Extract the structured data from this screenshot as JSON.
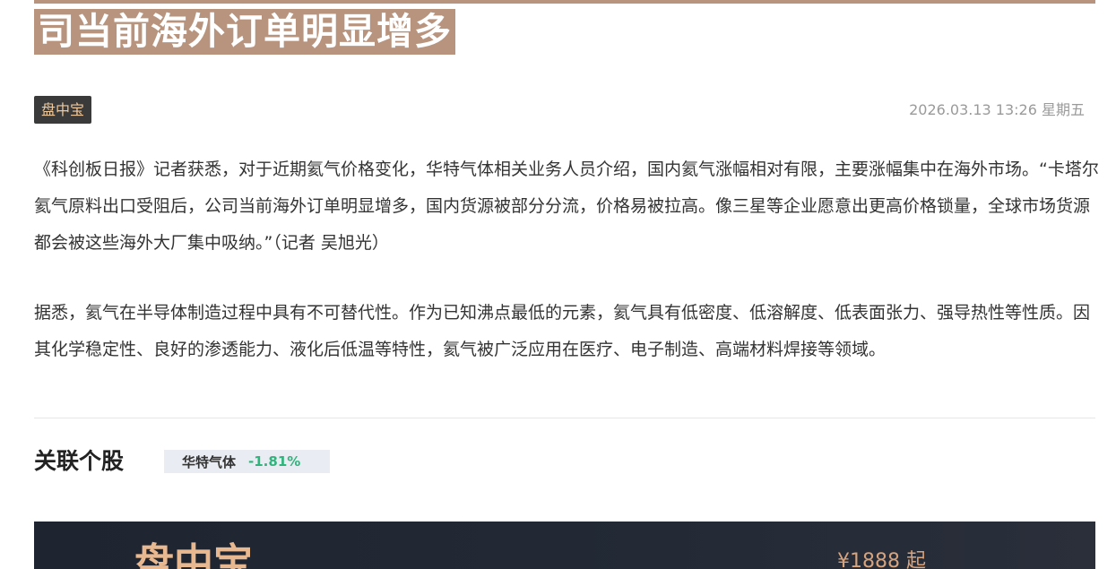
{
  "article": {
    "headline": "司当前海外订单明显增多",
    "source_tag": "盘中宝",
    "date": "2026.03.13 13:26 星期五",
    "paragraphs": [
      "《科创板日报》记者获悉，对于近期氦气价格变化，华特气体相关业务人员介绍，国内氦气涨幅相对有限，主要涨幅集中在海外市场。“卡塔尔氦气原料出口受阻后，公司当前海外订单明显增多，国内货源被部分分流，价格易被拉高。像三星等企业愿意出更高价格锁量，全球市场货源都会被这些海外大厂集中吸纳。”（记者 吴旭光）",
      "据悉，氦气在半导体制造过程中具有不可替代性。作为已知沸点最低的元素，氦气具有低密度、低溶解度、低表面张力、强导热性等性质。因其化学稳定性、良好的渗透能力、液化后低温等特性，氦气被广泛应用在医疗、电子制造、高端材料焊接等领域。"
    ]
  },
  "related": {
    "title": "关联个股",
    "stocks": [
      {
        "name": "华特气体",
        "change": "-1.81%"
      }
    ]
  },
  "banner": {
    "brand": "盘中宝",
    "price": "¥1888 起"
  },
  "colors": {
    "headline_bg": "#b8947e",
    "tag_bg": "#3a3a3a",
    "tag_text": "#f0c89a",
    "stock_change": "#2fb47c"
  }
}
